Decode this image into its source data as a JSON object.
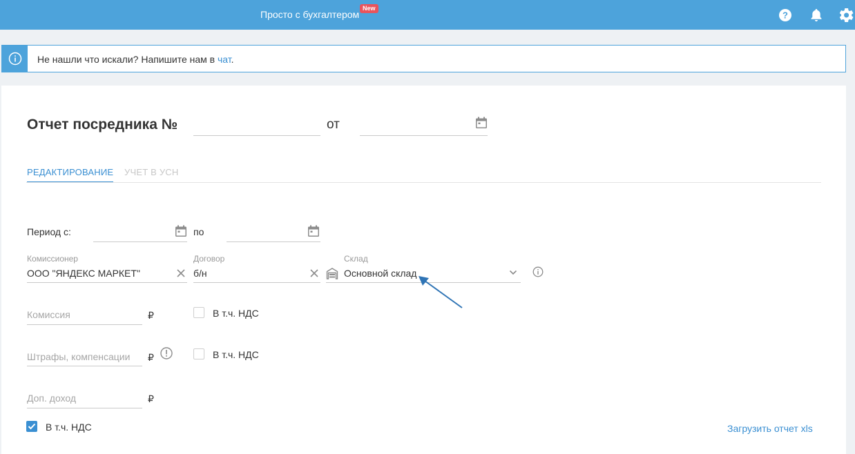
{
  "topbar": {
    "brand": "Просто с бухгалтером",
    "badge": "New",
    "icons": [
      "help-icon",
      "bell-icon",
      "gear-icon"
    ]
  },
  "banner": {
    "text_before": "Не нашли что искали? Напишите нам в ",
    "link": "чат",
    "text_after": "."
  },
  "document": {
    "title": "Отчет посредника №",
    "number": "",
    "date_label": "от",
    "date": ""
  },
  "tabs": [
    {
      "label": "РЕДАКТИРОВАНИЕ",
      "active": true
    },
    {
      "label": "УЧЕТ В УСН",
      "active": false
    }
  ],
  "period": {
    "from_label": "Период с:",
    "from": "",
    "to_label": "по",
    "to": ""
  },
  "fields": {
    "commissioner": {
      "label": "Комиссионер",
      "value": "ООО \"ЯНДЕКС МАРКЕТ\""
    },
    "contract": {
      "label": "Договор",
      "value": "б/н"
    },
    "warehouse": {
      "label": "Склад",
      "value": "Основной склад"
    }
  },
  "amounts": {
    "commission": {
      "placeholder": "Комиссия",
      "currency": "₽",
      "vat_label": "В т.ч. НДС",
      "vat_checked": false
    },
    "fines": {
      "placeholder": "Штрафы, компенсации",
      "currency": "₽",
      "vat_label": "В т.ч. НДС",
      "vat_checked": false
    },
    "extra_income": {
      "placeholder": "Доп. доход",
      "currency": "₽",
      "vat_label": "В т.ч. НДС",
      "vat_checked": true
    }
  },
  "upload_link": "Загрузить отчет xls",
  "colors": {
    "header": "#4da3db",
    "accent": "#3a8fd2",
    "badge": "#e9545c"
  }
}
